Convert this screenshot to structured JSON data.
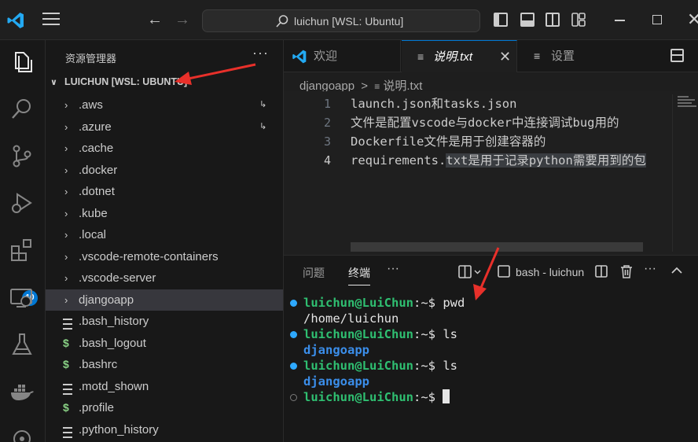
{
  "window": {
    "search_text": "luichun [WSL: Ubuntu]"
  },
  "activity_bar": {
    "extensions_badge": "10"
  },
  "sidebar": {
    "title": "资源管理器",
    "more": "···",
    "root_label": "LUICHUN [WSL: UBUNTU]",
    "items": [
      {
        "label": ".aws",
        "kind": "folder",
        "linked": true
      },
      {
        "label": ".azure",
        "kind": "folder",
        "linked": true
      },
      {
        "label": ".cache",
        "kind": "folder"
      },
      {
        "label": ".docker",
        "kind": "folder"
      },
      {
        "label": ".dotnet",
        "kind": "folder"
      },
      {
        "label": ".kube",
        "kind": "folder"
      },
      {
        "label": ".local",
        "kind": "folder"
      },
      {
        "label": ".vscode-remote-containers",
        "kind": "folder"
      },
      {
        "label": ".vscode-server",
        "kind": "folder"
      },
      {
        "label": "djangoapp",
        "kind": "folder",
        "selected": true
      },
      {
        "label": ".bash_history",
        "kind": "file"
      },
      {
        "label": ".bash_logout",
        "kind": "shell"
      },
      {
        "label": ".bashrc",
        "kind": "shell"
      },
      {
        "label": ".motd_shown",
        "kind": "file"
      },
      {
        "label": ".profile",
        "kind": "shell"
      },
      {
        "label": ".python_history",
        "kind": "file"
      }
    ]
  },
  "tabs": {
    "welcome": "欢迎",
    "readme": "说明.txt",
    "settings": "设置"
  },
  "breadcrumb": {
    "folder": "djangoapp",
    "separator": ">",
    "file": "说明.txt"
  },
  "editor": {
    "line_numbers": [
      "1",
      "2",
      "3",
      "4"
    ],
    "lines": [
      "launch.json和tasks.json",
      "文件是配置vscode与docker中连接调试bug用的",
      "Dockerfile文件是用于创建容器的"
    ],
    "line4_pre": "requirements.",
    "line4_hl": "txt是用于记录python需要用到的包"
  },
  "panel": {
    "tab_problems": "问题",
    "tab_terminal": "终端",
    "more": "···",
    "terminal_name": "bash - luichun"
  },
  "terminal": {
    "user": "luichun@LuiChun",
    "sep": ":~$",
    "cmd1": " pwd",
    "out1": "/home/luichun",
    "cmd2": " ls",
    "out2": "djangoapp",
    "cmd3": " ls",
    "out3": "djangoapp"
  },
  "colors": {
    "accent": "#0078d4",
    "prompt_green": "#2fbf71",
    "dir_blue": "#3b8eea",
    "annotation_red": "#e8302a"
  }
}
